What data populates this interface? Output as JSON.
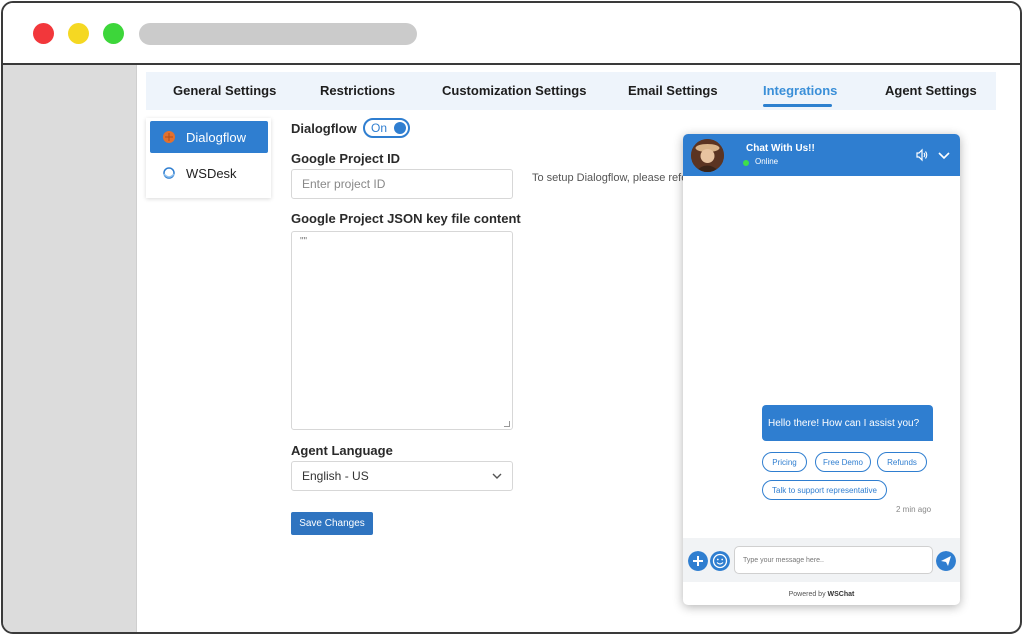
{
  "tabs": [
    {
      "label": "General Settings"
    },
    {
      "label": "Restrictions"
    },
    {
      "label": "Customization Settings"
    },
    {
      "label": "Email Settings"
    },
    {
      "label": "Integrations"
    },
    {
      "label": "Agent Settings"
    }
  ],
  "active_tab": "Integrations",
  "sidebar": {
    "items": [
      {
        "label": "Dialogflow",
        "icon": "dialogflow-icon",
        "active": true
      },
      {
        "label": "WSDesk",
        "icon": "wsdesk-icon",
        "active": false
      }
    ]
  },
  "form": {
    "dialogflow_label": "Dialogflow",
    "toggle_label": "On",
    "project_id_label": "Google Project ID",
    "project_id_placeholder": "Enter project ID",
    "helper_text": "To setup Dialogflow, please refer",
    "json_label": "Google Project JSON key file content",
    "json_value": "\"\"",
    "language_label": "Agent Language",
    "language_value": "English - US",
    "save_label": "Save Changes"
  },
  "chat": {
    "title": "Chat With Us!!",
    "status": "Online",
    "message": "Hello there! How can I assist you?",
    "quick_replies": [
      "Pricing",
      "Free Demo",
      "Refunds",
      "Talk to support representative"
    ],
    "timestamp": "2 min ago",
    "input_placeholder": "Type your message here..",
    "powered_prefix": "Powered by",
    "powered_brand": "WSChat"
  },
  "colors": {
    "accent": "#2f7ed0",
    "active_tab_text": "#3a8fd8",
    "online": "#3ee04a",
    "window_dot_red": "#f2373b",
    "window_dot_yellow": "#f5d822",
    "window_dot_green": "#3dd63a"
  }
}
